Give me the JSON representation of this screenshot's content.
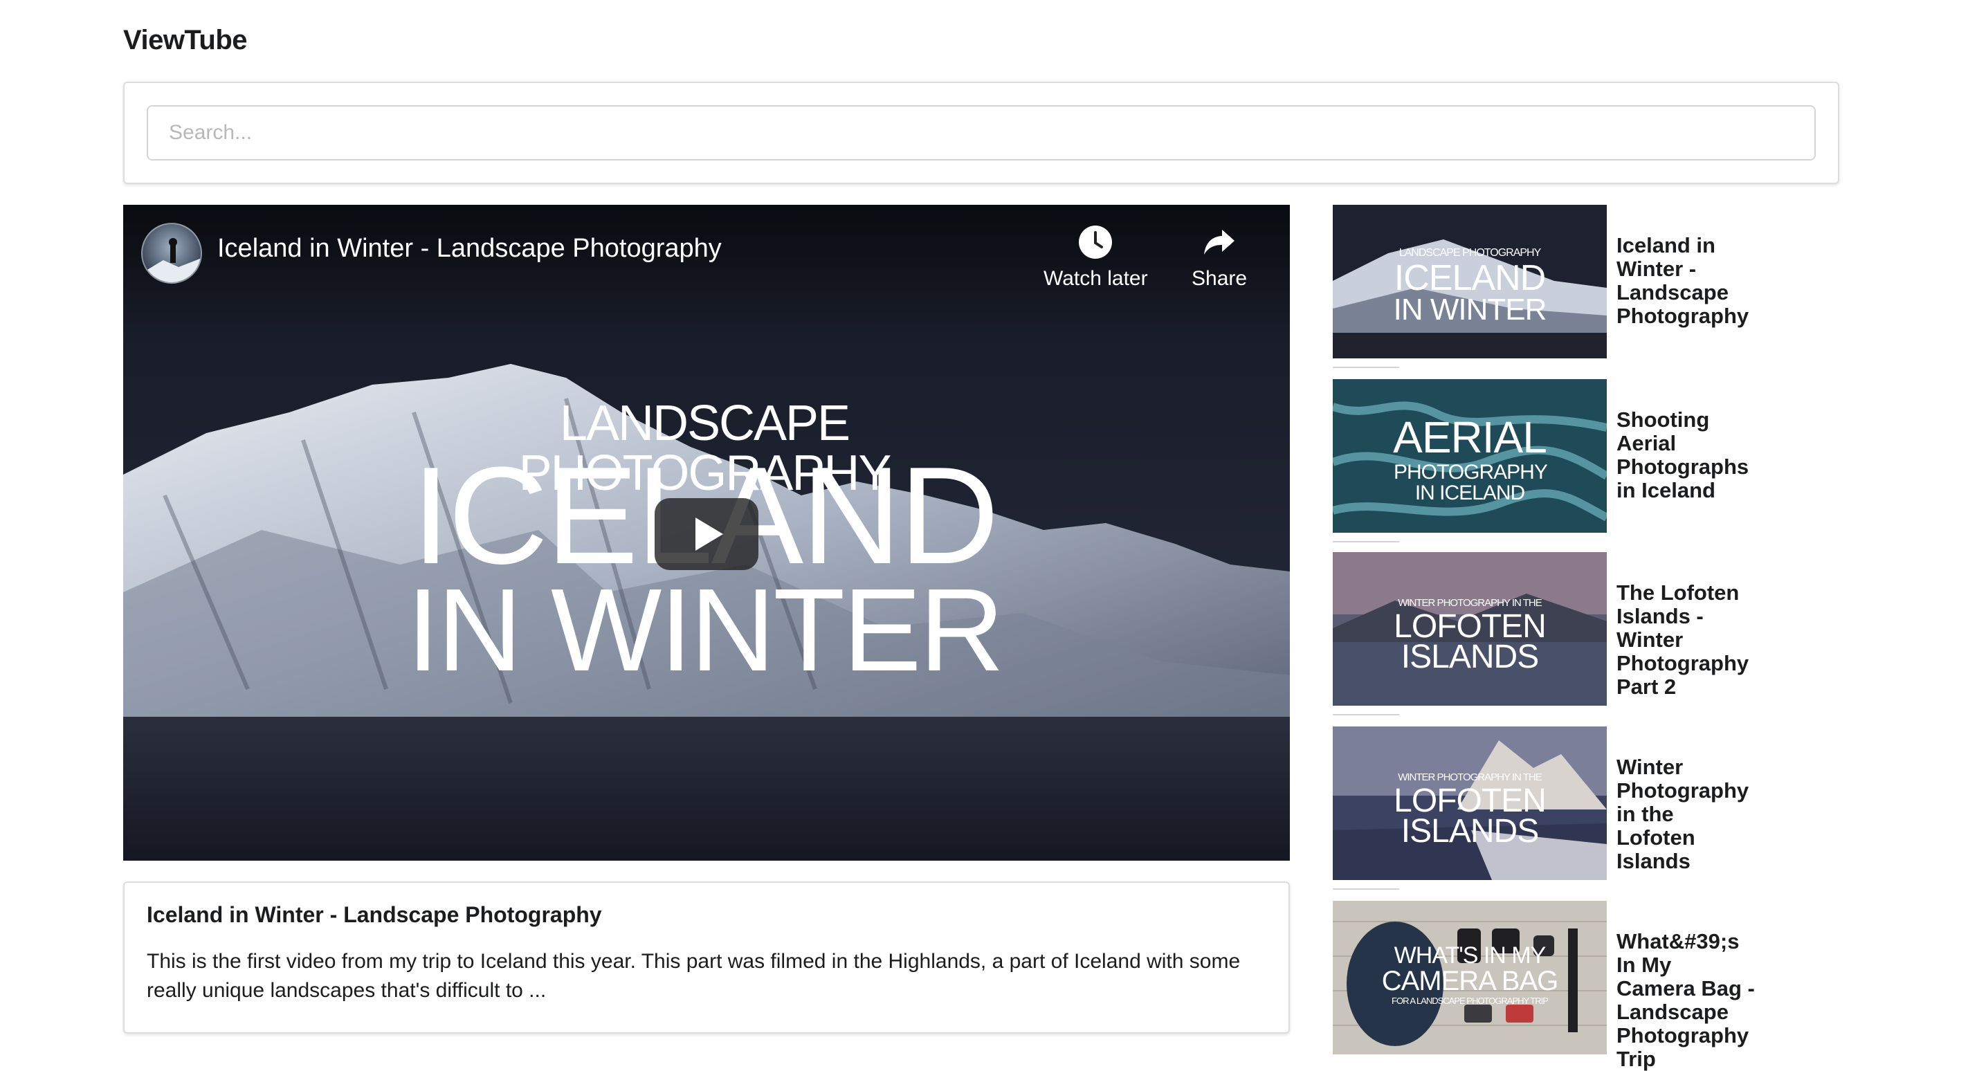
{
  "app": {
    "title": "ViewTube"
  },
  "search": {
    "placeholder": "Search...",
    "value": ""
  },
  "player": {
    "title": "Iceland in Winter - Landscape Photography",
    "watch_later_label": "Watch later",
    "share_label": "Share",
    "overlay_line1": "LANDSCAPE PHOTOGRAPHY",
    "overlay_line2": "ICELAND",
    "overlay_line3": "IN WINTER"
  },
  "detail": {
    "title": "Iceland in Winter - Landscape Photography",
    "description": "This is the first video from my trip to Iceland this year. This part was filmed in the Highlands, a part of Iceland with some really unique landscapes that's difficult to ..."
  },
  "videos": [
    {
      "title": "Iceland in Winter - Landscape Photography",
      "thumb_small": "LANDSCAPE PHOTOGRAPHY",
      "thumb_big1": "ICELAND",
      "thumb_big2": "IN WINTER",
      "palette": "snow"
    },
    {
      "title": "Shooting Aerial Photographs in Iceland",
      "thumb_small": "",
      "thumb_big1": "AERIAL",
      "thumb_big2": "PHOTOGRAPHY IN ICELAND",
      "palette": "aerial"
    },
    {
      "title": "The Lofoten Islands - Winter Photography Part 2",
      "thumb_small": "WINTER PHOTOGRAPHY IN THE",
      "thumb_big1": "LOFOTEN",
      "thumb_big2": "ISLANDS",
      "palette": "dusk"
    },
    {
      "title": "Winter Photography in the Lofoten Islands",
      "thumb_small": "WINTER PHOTOGRAPHY IN THE",
      "thumb_big1": "LOFOTEN",
      "thumb_big2": "ISLANDS",
      "palette": "peak"
    },
    {
      "title": "What&#39;s In My Camera Bag - Landscape Photography Trip",
      "thumb_small": "FOR A LANDSCAPE PHOTOGRAPHY TRIP",
      "thumb_big1": "WHAT'S IN MY",
      "thumb_big2": "CAMERA BAG",
      "palette": "wood"
    }
  ]
}
